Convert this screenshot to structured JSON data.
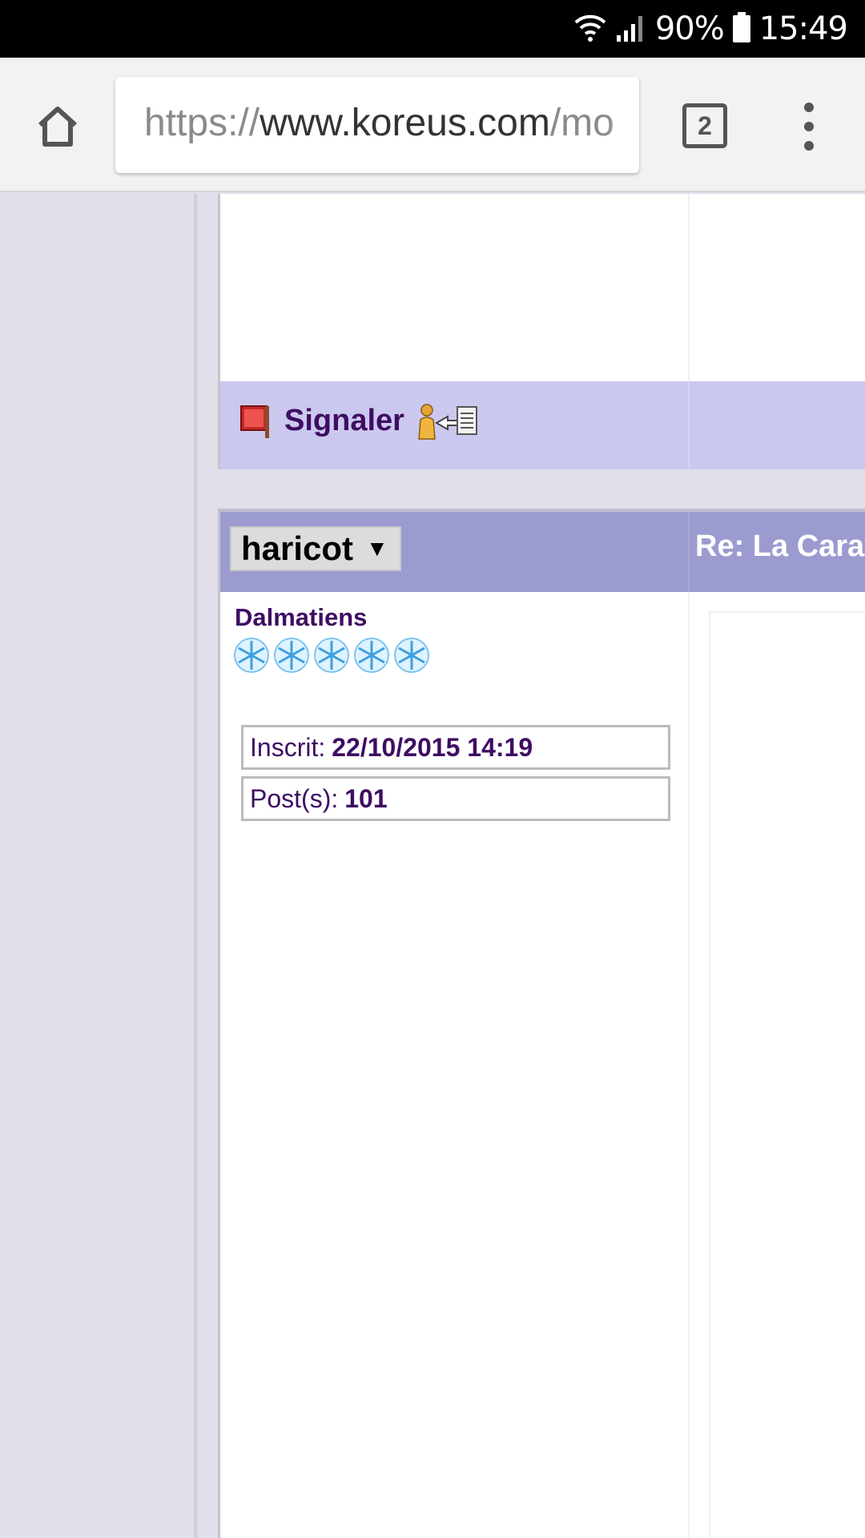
{
  "status_bar": {
    "battery": "90%",
    "time": "15:49",
    "icons": [
      "wifi-icon",
      "signal-icon",
      "battery-icon"
    ]
  },
  "browser": {
    "url_scheme": "https://",
    "url_host": "www.koreus.com",
    "url_path": "/mo",
    "tab_count": "2",
    "icons": [
      "home-icon",
      "tabs-icon",
      "menu-icon"
    ]
  },
  "post_actions": {
    "report_label": "Signaler",
    "icons": [
      "flag-icon",
      "profile-icon"
    ]
  },
  "post": {
    "username": "haricot",
    "dropdown_caret": "▼",
    "subject": "Re: La Carav",
    "rank": "Dalmatiens",
    "rank_stars": 5,
    "joined_label": "Inscrit:",
    "joined_value": "22/10/2015 14:19",
    "posts_label": "Post(s):",
    "posts_value": "101"
  },
  "colors": {
    "header_bar": "#9b9bd0",
    "signal_bar": "#cbc8ef",
    "text_purple": "#3e0d62",
    "page_bg": "#e0dfea"
  }
}
